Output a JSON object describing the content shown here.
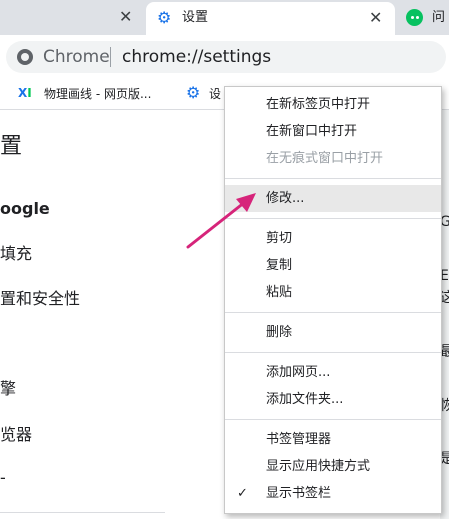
{
  "tabs": {
    "left_close": "✕",
    "active_title": "设置",
    "active_close": "✕",
    "right_title": "问"
  },
  "omnibox": {
    "label": "Chrome",
    "url": "chrome://settings"
  },
  "bookmarks": {
    "items": [
      {
        "label": "物理画线 - 网页版...",
        "icon": "xi-icon"
      },
      {
        "label": "设",
        "icon": "gear-icon"
      }
    ]
  },
  "sidebar": {
    "title": "置",
    "items": [
      "oogle",
      "填充",
      "置和安全性",
      "擎",
      "览器",
      "-"
    ]
  },
  "context_menu": {
    "groups": [
      [
        {
          "label": "在新标签页中打开",
          "enabled": true
        },
        {
          "label": "在新窗口中打开",
          "enabled": true
        },
        {
          "label": "在无痕式窗口中打开",
          "enabled": false
        }
      ],
      [
        {
          "label": "修改...",
          "enabled": true,
          "highlighted": true
        }
      ],
      [
        {
          "label": "剪切",
          "enabled": true
        },
        {
          "label": "复制",
          "enabled": true
        },
        {
          "label": "粘贴",
          "enabled": true
        }
      ],
      [
        {
          "label": "删除",
          "enabled": true
        }
      ],
      [
        {
          "label": "添加网页...",
          "enabled": true
        },
        {
          "label": "添加文件夹...",
          "enabled": true
        }
      ],
      [
        {
          "label": "书签管理器",
          "enabled": true
        },
        {
          "label": "显示应用快捷方式",
          "enabled": true
        },
        {
          "label": "显示书签栏",
          "enabled": true,
          "checked": true
        }
      ]
    ],
    "check_mark": "✓"
  },
  "right_edge_fragments": [
    "G",
    "E",
    "这",
    "最",
    "恢",
    "是"
  ],
  "annotation": {
    "arrow_color": "#d6247a"
  }
}
